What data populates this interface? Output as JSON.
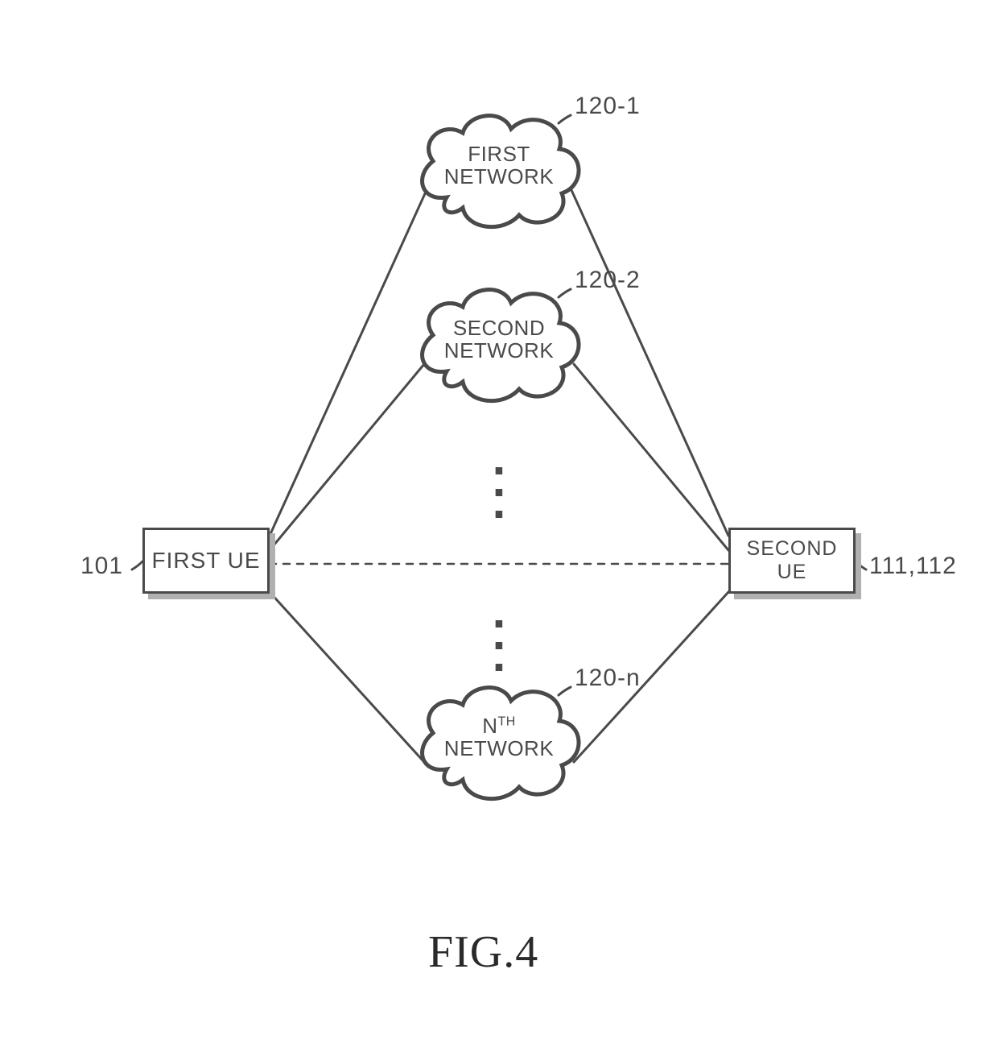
{
  "diagram": {
    "figure_caption": "FIG.4",
    "ue1": {
      "label": "FIRST UE",
      "ref": "101"
    },
    "ue2": {
      "label": "SECOND UE",
      "ref": "111,112"
    },
    "networks": {
      "n1": {
        "line1": "FIRST",
        "line2": "NETWORK",
        "ref": "120-1"
      },
      "n2": {
        "line1": "SECOND",
        "line2": "NETWORK",
        "ref": "120-2"
      },
      "nn": {
        "prefix": "N",
        "suffix": "TH",
        "line2": "NETWORK",
        "ref": "120-n"
      }
    }
  }
}
